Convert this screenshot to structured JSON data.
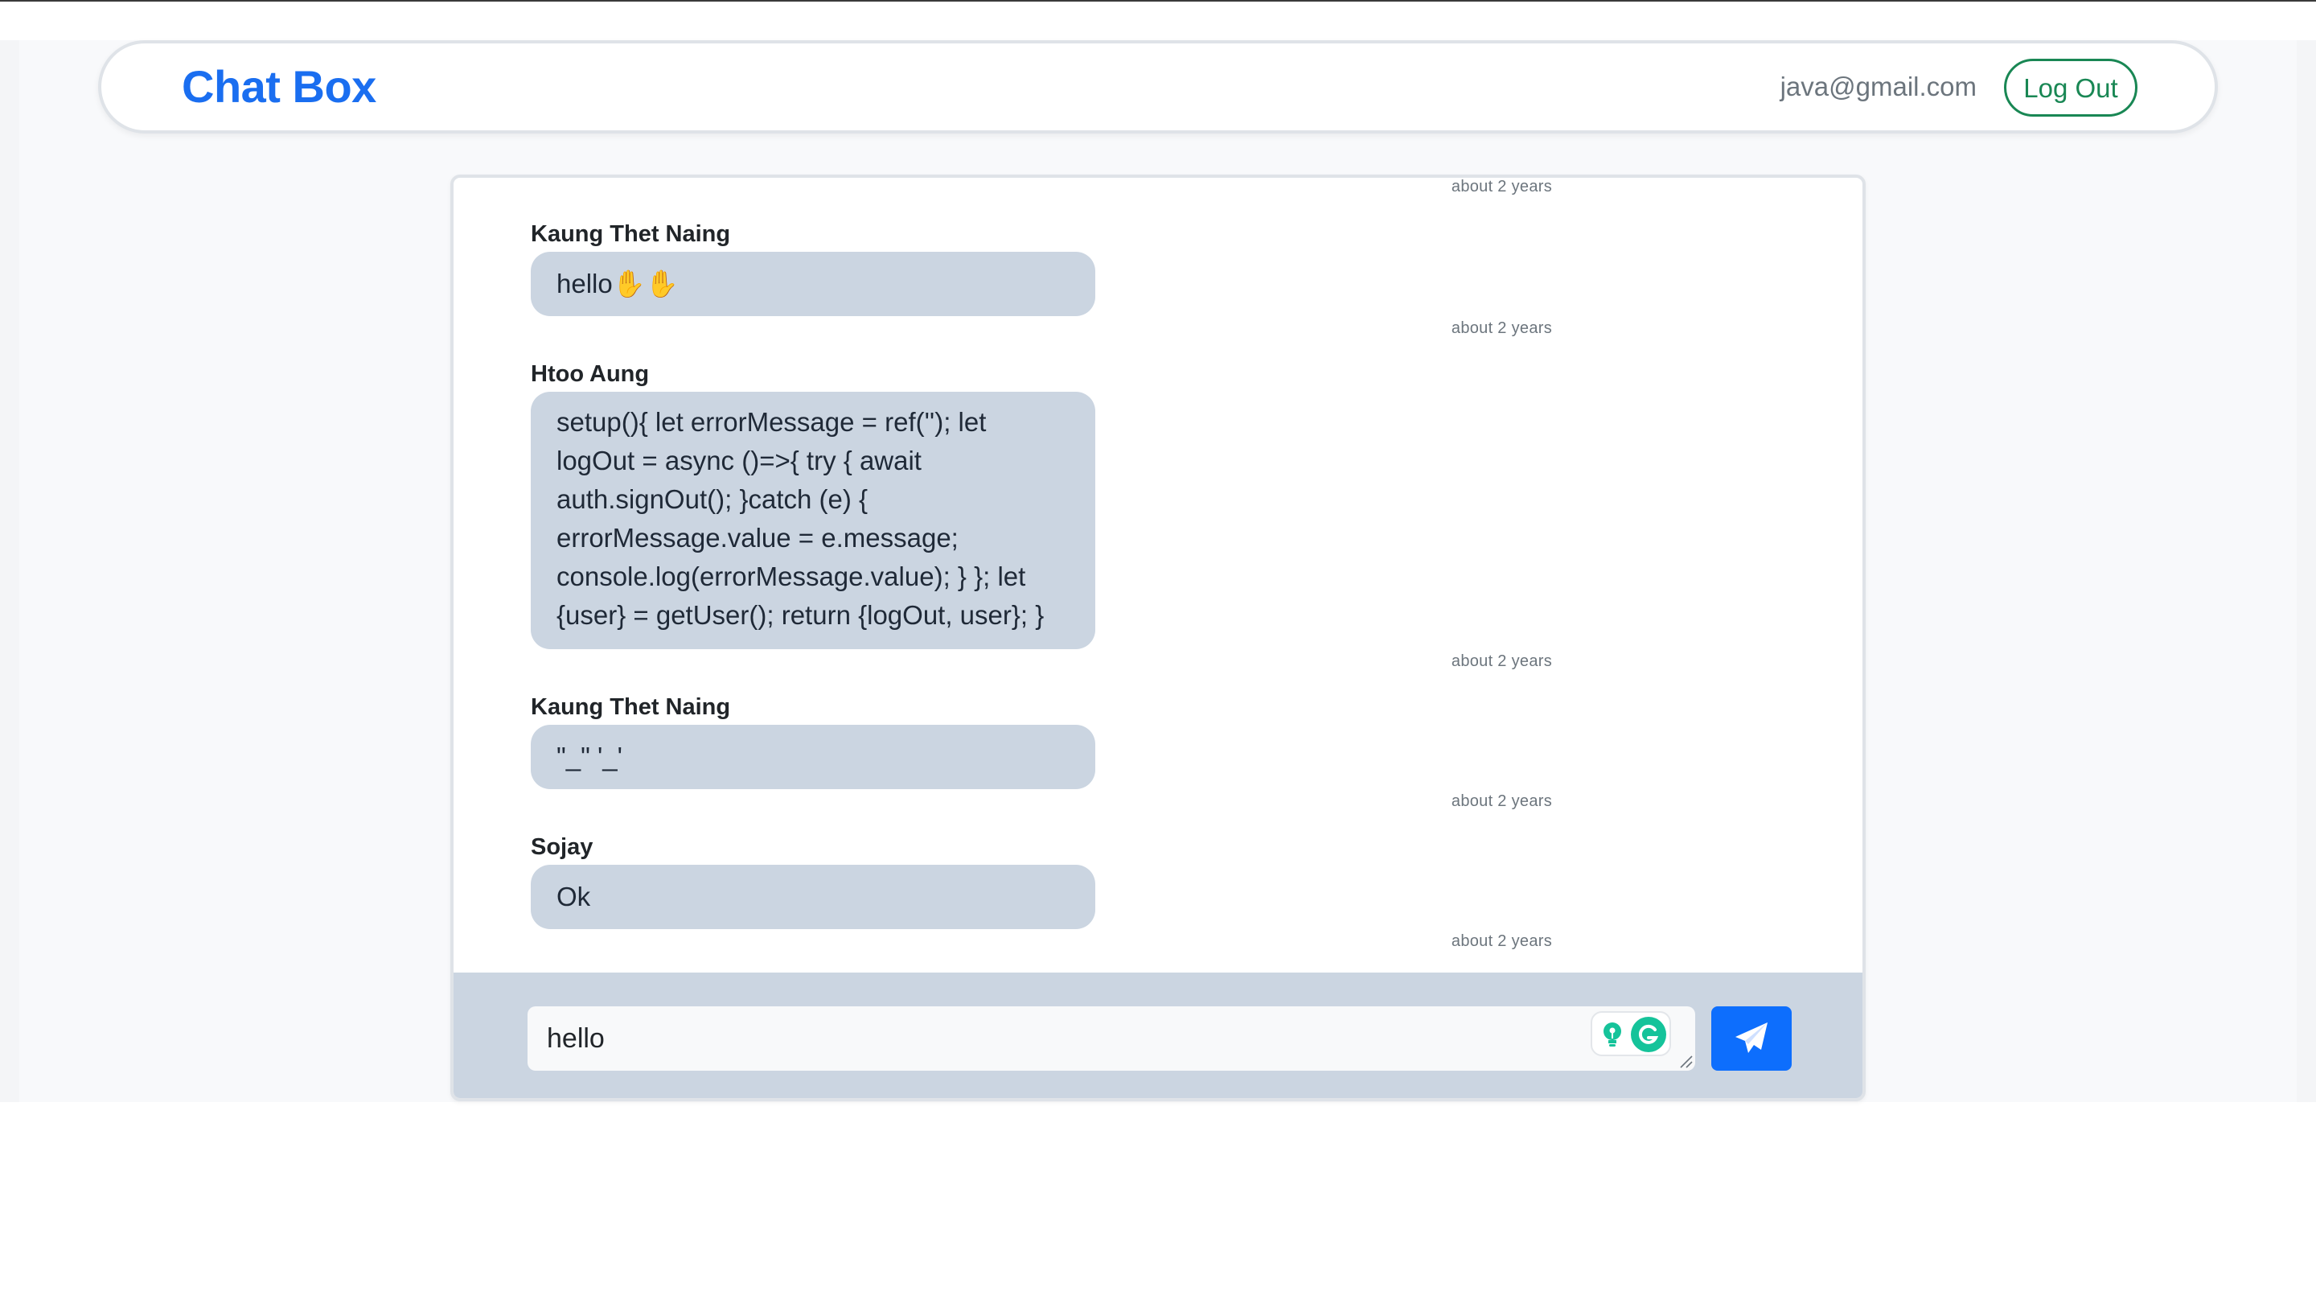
{
  "app": {
    "brand": "Chat Box",
    "user_email": "java@gmail.com",
    "logout_label": "Log Out"
  },
  "chat": {
    "top_time": "about 2 years",
    "messages": [
      {
        "name": "Kaung Thet Naing",
        "text": "hello✋✋",
        "time": "about 2 years"
      },
      {
        "name": "Htoo Aung",
        "text": "setup(){ let errorMessage = ref(''); let logOut = async ()=>{ try { await auth.signOut(); }catch (e) { errorMessage.value = e.message; console.log(errorMessage.value); } }; let {user} = getUser(); return {logOut, user}; }",
        "time": "about 2 years"
      },
      {
        "name": "Kaung Thet Naing",
        "text": "\"_\" '_'",
        "time": "about 2 years"
      },
      {
        "name": "Sojay",
        "text": "Ok",
        "time": "about 2 years"
      }
    ]
  },
  "composer": {
    "input_value": "hello",
    "send_icon": "paper-plane-icon",
    "grammarly_icons": [
      "lightbulb-icon",
      "grammarly-icon"
    ]
  },
  "colors": {
    "brand": "#1a6ef0",
    "logout": "#198754",
    "bubble": "#cbd5e1",
    "send": "#0d6efd"
  }
}
